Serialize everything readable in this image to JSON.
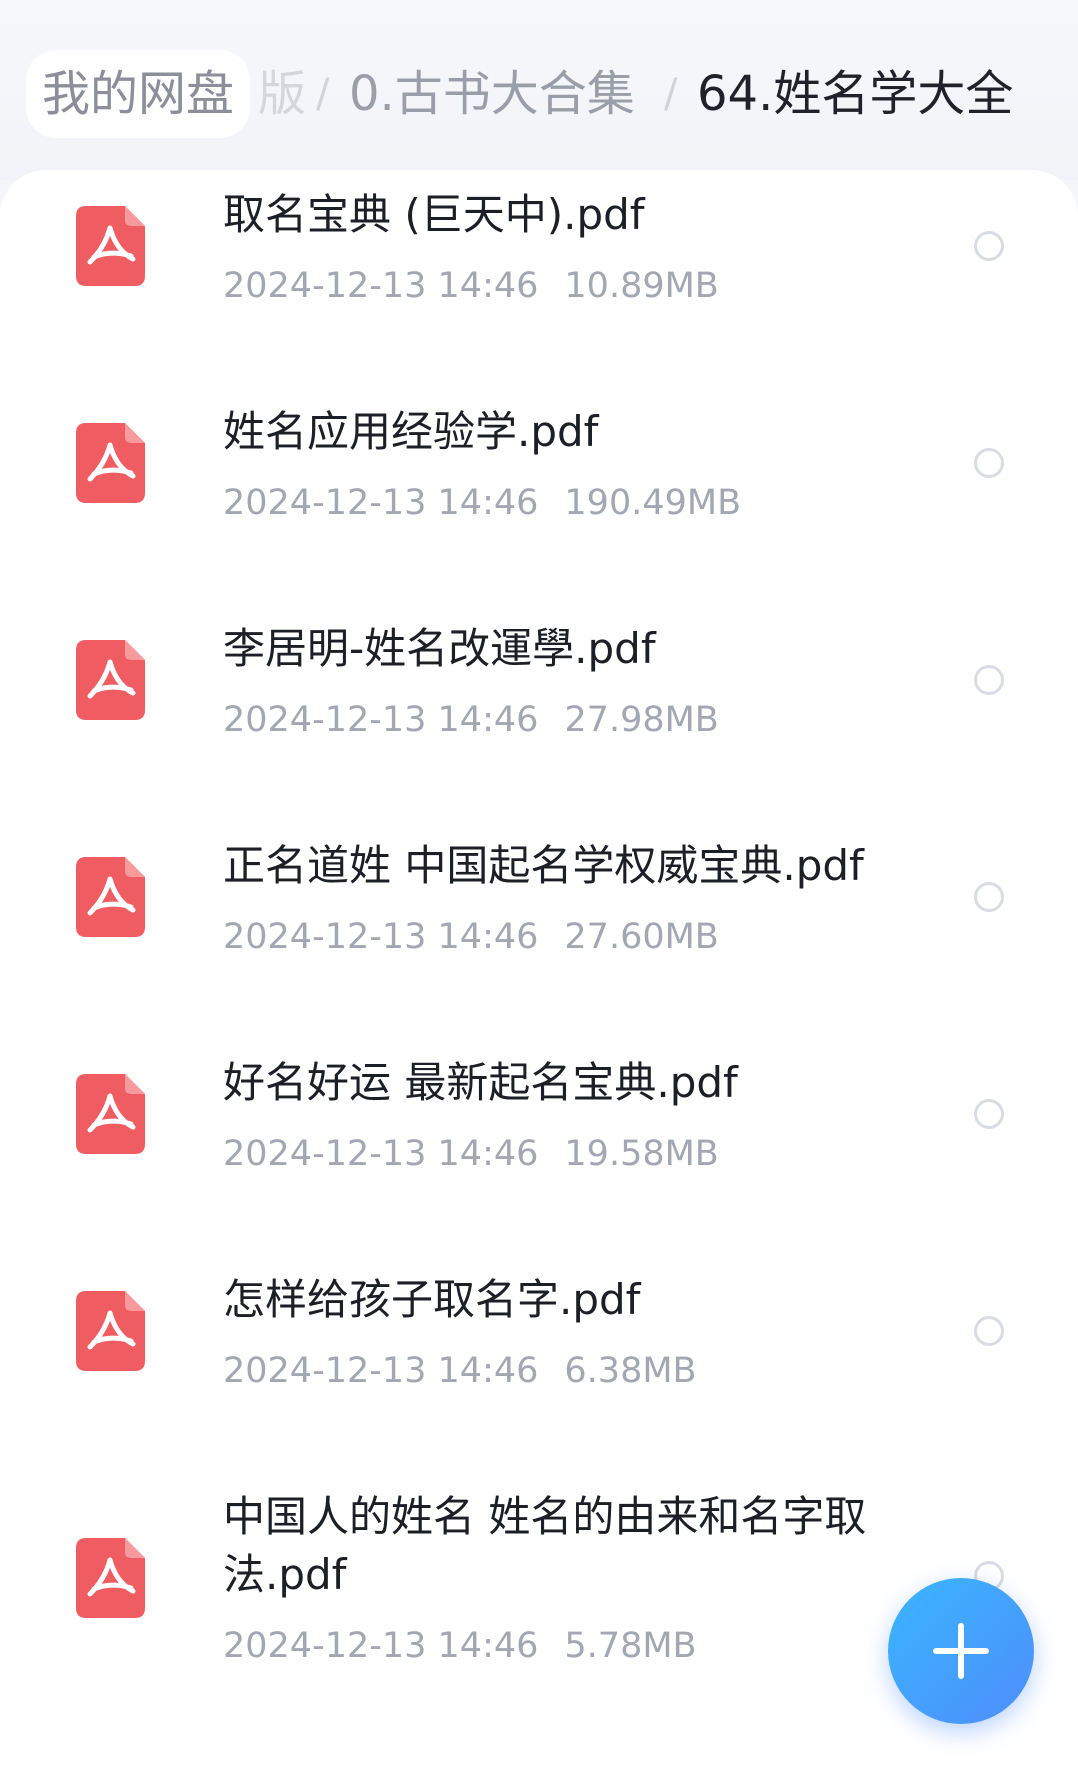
{
  "breadcrumb": {
    "root": "我的网盘",
    "faded": "版",
    "separator": "/",
    "parent": "0.古书大合集",
    "current": "64.姓名学大全"
  },
  "files": [
    {
      "name": "取名宝典 (巨天中).pdf",
      "date": "2024-12-13  14:46",
      "size": "10.89MB",
      "icon": "pdf-icon"
    },
    {
      "name": "姓名应用经验学.pdf",
      "date": "2024-12-13  14:46",
      "size": "190.49MB",
      "icon": "pdf-icon"
    },
    {
      "name": "李居明-姓名改運學.pdf",
      "date": "2024-12-13  14:46",
      "size": "27.98MB",
      "icon": "pdf-icon"
    },
    {
      "name": "正名道姓 中国起名学权威宝典.pdf",
      "date": "2024-12-13  14:46",
      "size": "27.60MB",
      "icon": "pdf-icon"
    },
    {
      "name": "好名好运 最新起名宝典.pdf",
      "date": "2024-12-13  14:46",
      "size": "19.58MB",
      "icon": "pdf-icon"
    },
    {
      "name": "怎样给孩子取名字.pdf",
      "date": "2024-12-13  14:46",
      "size": "6.38MB",
      "icon": "pdf-icon"
    },
    {
      "name": "中国人的姓名 姓名的由来和名字取法.pdf",
      "date": "2024-12-13  14:46",
      "size": "5.78MB",
      "icon": "pdf-icon"
    }
  ],
  "fab": {
    "icon": "plus-icon"
  },
  "colors": {
    "pdf_red": "#ef5d62",
    "fab_blue": "#3f9ffb",
    "text_primary": "#1c1f26",
    "text_secondary": "#a3a7b1"
  }
}
